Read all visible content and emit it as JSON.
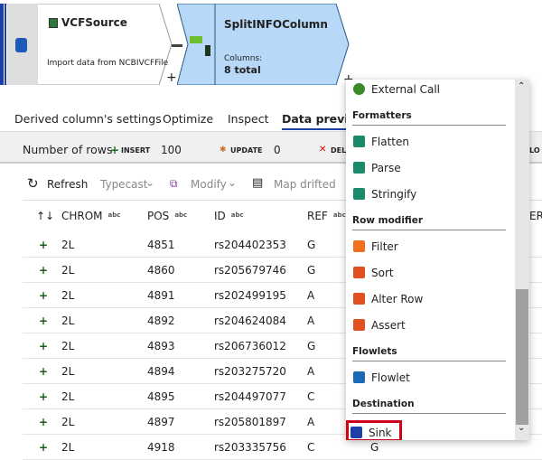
{
  "canvas": {
    "source": {
      "title": "VCFSource",
      "description": "Import data from NCBIVCFFile"
    },
    "derived": {
      "title": "SplitINFOColumn",
      "columns_label": "Columns:",
      "columns_value": "8 total"
    },
    "add_label": "+"
  },
  "tabs": [
    {
      "label": "Derived column's settings"
    },
    {
      "label": "Optimize"
    },
    {
      "label": "Inspect"
    },
    {
      "label": "Data preview",
      "active": true
    }
  ],
  "stats": {
    "label": "Number of rows",
    "insert_label": "INSERT",
    "insert_value": "100",
    "update_label": "UPDATE",
    "update_value": "0",
    "delete_label": "DEL",
    "lookup_label": "LO"
  },
  "toolbar": {
    "refresh": "Refresh",
    "typecast": "Typecast",
    "modify": "Modify",
    "map_drifted": "Map drifted"
  },
  "table": {
    "sort_icon": "↑↓",
    "type_badge": "abc",
    "columns": [
      "CHROM",
      "POS",
      "ID",
      "REF"
    ],
    "hidden_col": "ER",
    "rows": [
      [
        "2L",
        "4851",
        "rs204402353",
        "G"
      ],
      [
        "2L",
        "4860",
        "rs205679746",
        "G"
      ],
      [
        "2L",
        "4891",
        "rs202499195",
        "A"
      ],
      [
        "2L",
        "4892",
        "rs204624084",
        "A"
      ],
      [
        "2L",
        "4893",
        "rs206736012",
        "G"
      ],
      [
        "2L",
        "4894",
        "rs203275720",
        "A"
      ],
      [
        "2L",
        "4895",
        "rs204497077",
        "C"
      ],
      [
        "2L",
        "4897",
        "rs205801897",
        "A"
      ],
      [
        "2L",
        "4918",
        "rs203335756",
        "C"
      ]
    ],
    "last_row_extra": "G"
  },
  "menu": {
    "items_top": [
      {
        "label": "External Call",
        "icon": "external-call-icon"
      }
    ],
    "sections": [
      {
        "title": "Formatters",
        "items": [
          {
            "label": "Flatten",
            "icon": "flatten-icon"
          },
          {
            "label": "Parse",
            "icon": "parse-icon"
          },
          {
            "label": "Stringify",
            "icon": "stringify-icon"
          }
        ]
      },
      {
        "title": "Row modifier",
        "items": [
          {
            "label": "Filter",
            "icon": "filter-icon"
          },
          {
            "label": "Sort",
            "icon": "sort-icon"
          },
          {
            "label": "Alter Row",
            "icon": "alter-row-icon"
          },
          {
            "label": "Assert",
            "icon": "assert-icon"
          }
        ]
      },
      {
        "title": "Flowlets",
        "items": [
          {
            "label": "Flowlet",
            "icon": "flowlet-icon"
          }
        ]
      },
      {
        "title": "Destination",
        "items": [
          {
            "label": "Sink",
            "icon": "sink-icon",
            "highlighted": true
          }
        ]
      }
    ],
    "highlight_color": "#d0021b"
  }
}
